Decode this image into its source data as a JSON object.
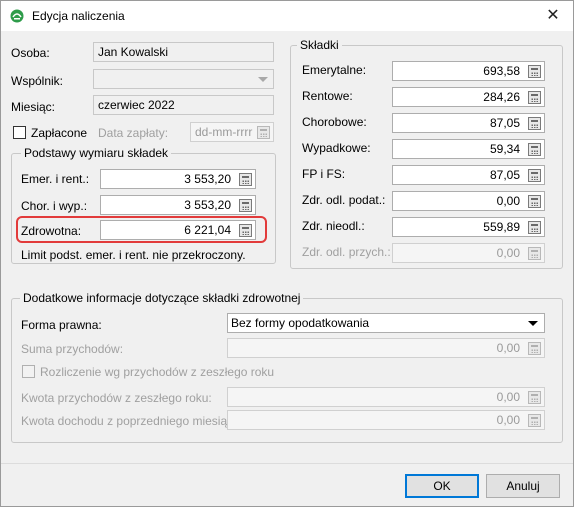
{
  "window": {
    "title": "Edycja naliczenia",
    "app_icon": "app-logo-icon",
    "close_glyph": "✕"
  },
  "left": {
    "osoba_label": "Osoba:",
    "osoba_value": "Jan Kowalski",
    "wspolnik_label": "Wspólnik:",
    "wspolnik_value": "",
    "miesiac_label": "Miesiąc:",
    "miesiac_value": "czerwiec 2022",
    "zaplacone_label": "Zapłacone",
    "zaplacone_checked": false,
    "data_zaplaty_label": "Data zapłaty:",
    "data_zaplaty_placeholder": "dd-mm-rrrr"
  },
  "podstawy": {
    "title": "Podstawy wymiaru składek",
    "rows": [
      {
        "label": "Emer. i rent.:",
        "value": "3 553,20"
      },
      {
        "label": "Chor. i wyp.:",
        "value": "3 553,20"
      },
      {
        "label": "Zdrowotna:",
        "value": "6 221,04"
      }
    ],
    "note": "Limit podst. emer. i rent. nie przekroczony.",
    "highlight_color": "#e23b3b"
  },
  "skladki": {
    "title": "Składki",
    "rows": [
      {
        "label": "Emerytalne:",
        "value": "693,58"
      },
      {
        "label": "Rentowe:",
        "value": "284,26"
      },
      {
        "label": "Chorobowe:",
        "value": "87,05"
      },
      {
        "label": "Wypadkowe:",
        "value": "59,34"
      },
      {
        "label": "FP i FS:",
        "value": "87,05"
      },
      {
        "label": "Zdr. odl. podat.:",
        "value": "0,00"
      },
      {
        "label": "Zdr. nieodl.:",
        "value": "559,89"
      },
      {
        "label": "Zdr. odl. przych.:",
        "value": "0,00"
      }
    ]
  },
  "dodatkowe": {
    "title": "Dodatkowe informacje dotyczące składki zdrowotnej",
    "forma_label": "Forma prawna:",
    "forma_value": "Bez formy opodatkowania",
    "suma_label": "Suma przychodów:",
    "suma_value": "0,00",
    "rozliczenie_label": "Rozliczenie wg przychodów z zeszłego roku",
    "kwota_przychodow_label": "Kwota przychodów z zeszłego roku:",
    "kwota_przychodow_value": "0,00",
    "kwota_dochodu_label": "Kwota dochodu z poprzedniego miesiąca:",
    "kwota_dochodu_value": "0,00"
  },
  "footer": {
    "ok_label": "OK",
    "cancel_label": "Anuluj"
  }
}
